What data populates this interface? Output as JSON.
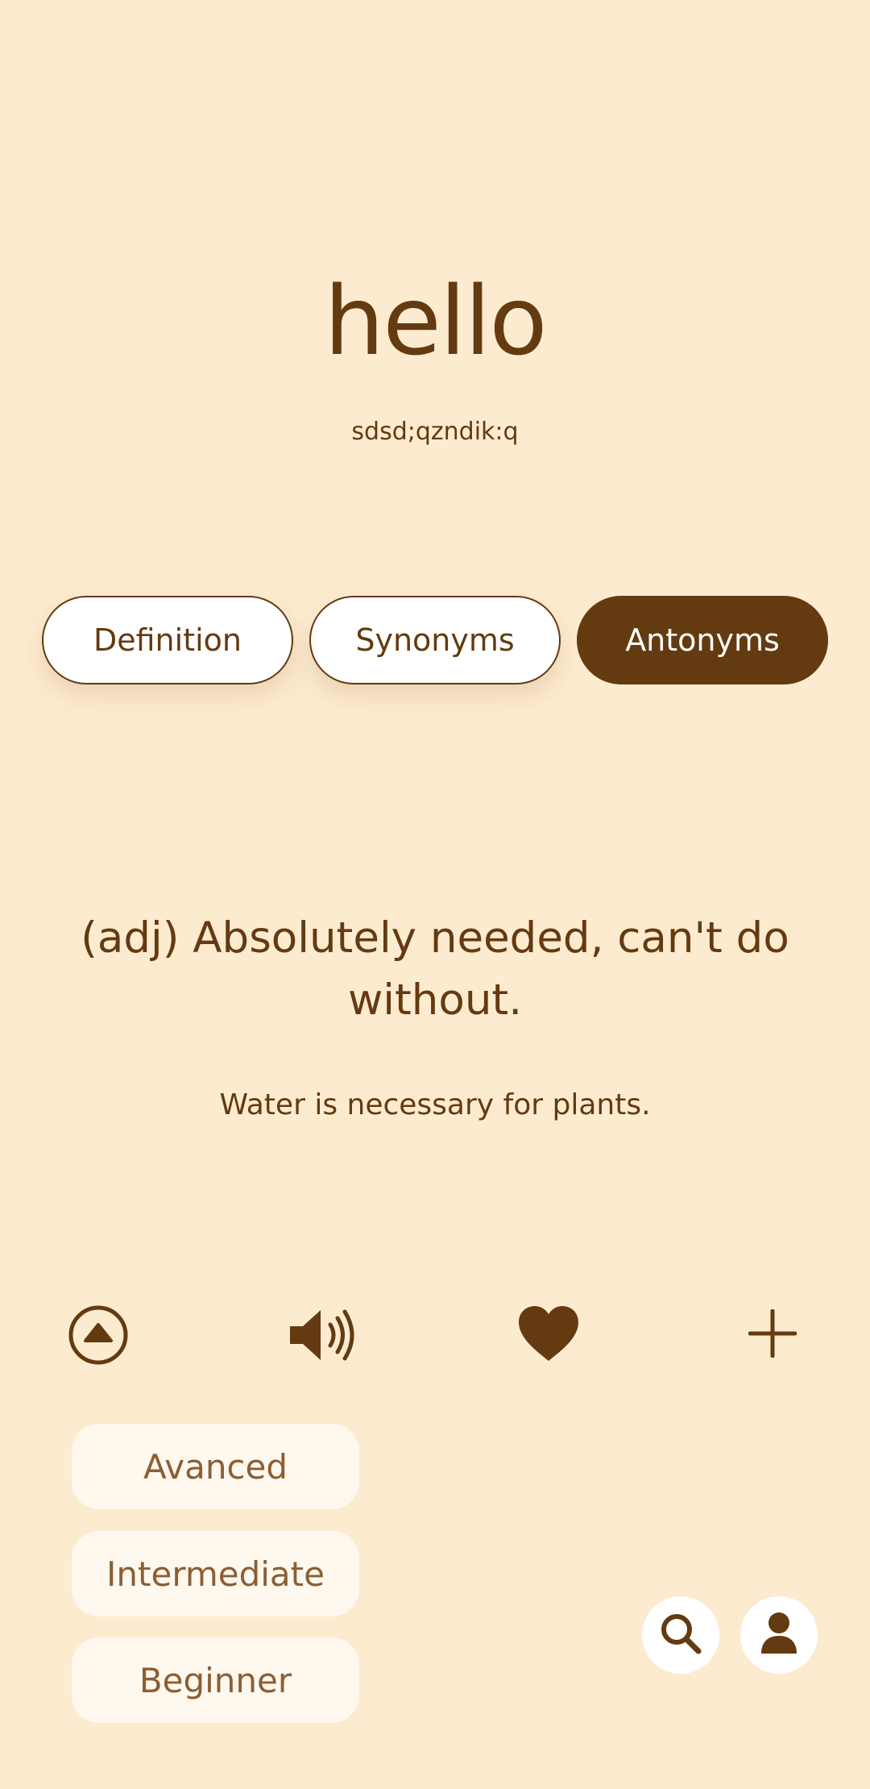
{
  "word": {
    "text": "hello",
    "phonetic": "sdsd;qzndik:q"
  },
  "tabs": [
    {
      "label": "Definition",
      "active": false
    },
    {
      "label": "Synonyms",
      "active": false
    },
    {
      "label": "Antonyms",
      "active": true
    }
  ],
  "content": {
    "definition": "(adj) Absolutely needed, can't do without.",
    "example": "Water is necessary for plants."
  },
  "actions": {
    "icons": [
      "arrow-up-circle-icon",
      "speaker-icon",
      "heart-icon",
      "plus-icon"
    ]
  },
  "levels": [
    {
      "label": "Avanced"
    },
    {
      "label": "Intermediate"
    },
    {
      "label": "Beginner"
    }
  ],
  "fabs": {
    "icons": [
      "search-icon",
      "user-icon"
    ]
  },
  "colors": {
    "background": "#FDEBD0",
    "primary": "#643A10",
    "tab_inactive_bg": "#FFFFFF",
    "level_bg": "#FFF8EE",
    "level_text": "#8B5E34"
  }
}
